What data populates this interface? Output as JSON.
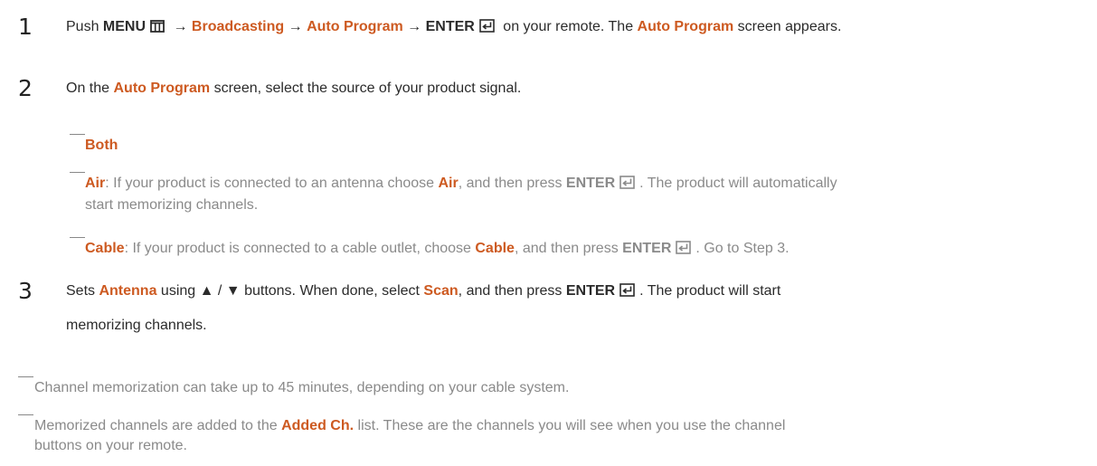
{
  "steps": [
    {
      "num": "1",
      "p1": "Push ",
      "menu": "MENU",
      "arrow1": " → ",
      "broadcasting": "Broadcasting",
      "arrow2": " → ",
      "auto_program": "Auto Program",
      "arrow3": " → ",
      "enter": "ENTER",
      "p2": " on your remote. The ",
      "auto_program2": "Auto Program",
      "p3": " screen appears."
    },
    {
      "num": "2",
      "p1": "On the ",
      "auto_program": "Auto Program",
      "p2": " screen, select the source of your product signal."
    },
    {
      "num": "3",
      "p1": "Sets ",
      "antenna": "Antenna",
      "p2": " using ",
      "arrows": "▲ / ▼",
      "p3": " buttons. When done, select ",
      "scan": "Scan",
      "p4": ", and then press ",
      "enter": "ENTER",
      "p5": ". The product will start",
      "p6": "memorizing channels."
    }
  ],
  "sources": [
    {
      "label": "Both"
    },
    {
      "label": "Air",
      "t1": ": If your product is connected to an antenna choose ",
      "air2": "Air",
      "t2": ", and then press ",
      "enter": "ENTER",
      "t3": ". The product will automatically",
      "t4": "start memorizing channels."
    },
    {
      "label": "Cable",
      "t1": ": If your product is connected to a cable outlet, choose ",
      "cable2": "Cable",
      "t2": ", and then press ",
      "enter": "ENTER",
      "t3": ". Go to Step 3."
    }
  ],
  "notes": [
    {
      "text": "Channel memorization can take up to 45 minutes, depending on your cable system."
    },
    {
      "t1": "Memorized channels are added to the ",
      "added": "Added Ch.",
      "t2": " list. These are the channels you will see when you use the channel",
      "t3": "buttons on your remote."
    }
  ],
  "colors": {
    "accent": "#cd5a21",
    "body_text": "#2b2b2b",
    "note_text": "#8a8a8a"
  },
  "icons": {
    "menu": "menu-icon",
    "enter": "enter-icon"
  }
}
